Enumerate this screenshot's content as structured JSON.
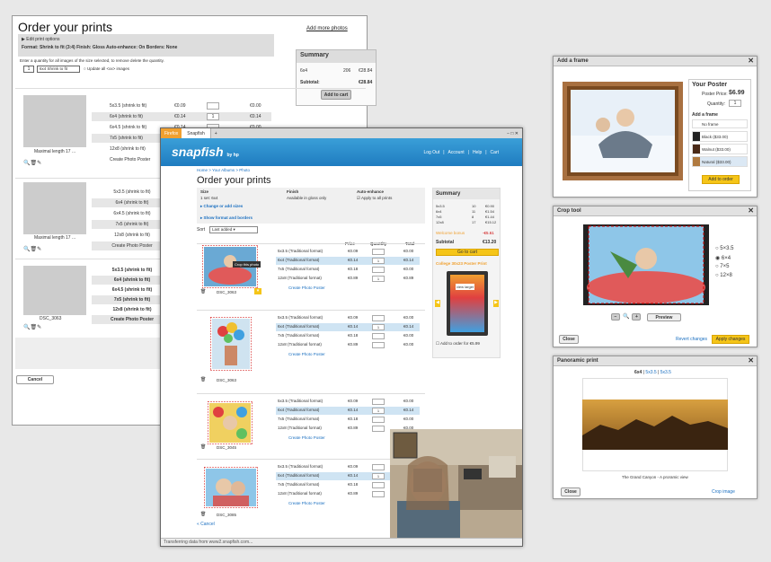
{
  "wireframe": {
    "title": "Order your prints",
    "add_more": "Add more photos",
    "edit_options": "Edit print options",
    "format_line": "Format: Shrink to fit (3:4)   Finish: Gloss   Auto-enhance: On   Borders: None",
    "instruction": "Enter a quantity for all images of the size selected, to remove delete the quantity.",
    "qty_value": "1",
    "size_select": "6x4  Shrink to fit",
    "update_all": "Update all <xx> images",
    "summary_title": "Summary",
    "summary_row": [
      "6x4",
      "206",
      "€28.84"
    ],
    "subtotal_label": "Subtotal:",
    "subtotal_value": "€28.84",
    "add_to_cart": "Add to cart",
    "block1_rows": [
      {
        "label": "5x3.5 (shrink to fit)",
        "price": "€0.09",
        "qty": "",
        "total": "€0.00"
      },
      {
        "label": "6x4 (shrink to fit)",
        "price": "€0.14",
        "qty": "1",
        "total": "€0.14"
      },
      {
        "label": "6x4.5 (shrink to fit)",
        "price": "€0.14",
        "qty": "",
        "total": "€0.00"
      },
      {
        "label": "7x5 (shrink to fit)",
        "price": "€0.18",
        "qty": "",
        "total": "€0.00"
      },
      {
        "label": "12x8 (shrink to fit)",
        "price": "€0.18",
        "qty": "",
        "total": "€0.00"
      },
      {
        "label": "Create Photo Poster",
        "price": "",
        "qty": "",
        "total": ""
      }
    ],
    "caption1": "Maximal length 17 ...",
    "block2_rows": [
      "5x3.5 (shrink to fit)",
      "6x4 (shrink to fit)",
      "6x4.5 (shrink to fit)",
      "7x5 (shrink to fit)",
      "12x8 (shrink to fit)",
      "Create Photo Poster"
    ],
    "caption2": "Maximal length 17 ...",
    "block3_rows": [
      "5x3.5 (shrink to fit)",
      "6x4 (shrink to fit)",
      "6x4.5 (shrink to fit)",
      "7x5 (shrink to fit)",
      "12x8 (shrink to fit)",
      "Create Photo Poster"
    ],
    "caption3": "DSC_3063",
    "cancel": "Cancel"
  },
  "browser": {
    "tab1": "Firefox",
    "tab2": "Snapfish",
    "tab_add": "+",
    "logo": "snapfish",
    "logo_by": "by hp",
    "nav": [
      "Log Out",
      "Account",
      "Help",
      "Cart"
    ],
    "breadcrumb": "Home > Your Albums > Photo",
    "title": "Order your prints",
    "options_headers": [
      "Size",
      "Finish",
      "Auto-enhance"
    ],
    "options_values": [
      "1 set: 6x4",
      "Available in gloss only",
      "Apply to all prints"
    ],
    "change_sizes": "Change or add sizes",
    "show_format": "Show format and borders",
    "sort_label": "Sort",
    "sort_value": "Last added",
    "col_headers": [
      "Price",
      "Quantity",
      "Total"
    ],
    "summary_title": "Summary",
    "summary_rows": [
      [
        "5x3.5",
        "10",
        "€0.90"
      ],
      [
        "6x4",
        "11",
        "€1.54"
      ],
      [
        "7x5",
        "8",
        "€1.44"
      ],
      [
        "12x8",
        "17",
        "€15.12"
      ]
    ],
    "welcome_bonus": "Welcome bonus",
    "welcome_value": "-€5.61",
    "subtotal_label": "Subtotal",
    "subtotal_value": "€13.20",
    "go_to_cart": "Go to cart",
    "poster_title": "College 30x23 Poster Print",
    "poster_btn": "view larger",
    "add_to_order": "Add to order for €5.99",
    "groups": [
      {
        "name": "DSC_3063",
        "rows": [
          [
            "5x3.5 (Traditional format)",
            "€0.09",
            "",
            "€0.00"
          ],
          [
            "6x4 (Traditional format)",
            "€0.14",
            "1",
            "€0.14"
          ],
          [
            "7x5 (Traditional format)",
            "€0.18",
            "",
            "€0.00"
          ],
          [
            "12x8 (Traditional format)",
            "€0.89",
            "1",
            "€0.89"
          ]
        ],
        "poster": "Create Photo Poster",
        "crop_tag": "Crop this photo"
      },
      {
        "name": "DSC_3063",
        "rows": [
          [
            "5x3.5 (Traditional format)",
            "€0.09",
            "",
            "€0.00"
          ],
          [
            "6x4 (Traditional format)",
            "€0.14",
            "1",
            "€0.14"
          ],
          [
            "7x5 (Traditional format)",
            "€0.18",
            "",
            "€0.00"
          ],
          [
            "12x8 (Traditional format)",
            "€0.89",
            "",
            "€0.00"
          ]
        ],
        "poster": "Create Photo Poster"
      },
      {
        "name": "DSC_3045",
        "rows": [
          [
            "5x3.5 (Traditional format)",
            "€0.09",
            "",
            "€0.00"
          ],
          [
            "6x4 (Traditional format)",
            "€0.14",
            "1",
            "€0.14"
          ],
          [
            "7x5 (Traditional format)",
            "€0.18",
            "",
            "€0.00"
          ],
          [
            "12x8 (Traditional format)",
            "€0.89",
            "",
            "€0.00"
          ]
        ],
        "poster": "Create Photo Poster"
      },
      {
        "name": "DSC_3085",
        "rows": [
          [
            "5x3.5 (Traditional format)",
            "€0.09",
            "",
            "€0.00"
          ],
          [
            "6x4 (Traditional format)",
            "€0.14",
            "1",
            "€0.14"
          ],
          [
            "7x5 (Traditional format)",
            "€0.18",
            "",
            "€0.00"
          ],
          [
            "12x8 (Traditional format)",
            "€0.89",
            "",
            "€0.00"
          ]
        ],
        "poster": "Create Photo Poster"
      }
    ],
    "cancel": "« Cancel",
    "status": "Transferring data from www2.snapfish.com..."
  },
  "frame_dialog": {
    "title": "Add a frame",
    "poster_title": "Your Poster",
    "price_label": "Poster Price:",
    "price": "$6.99",
    "qty_label": "Quantity:",
    "qty": "1",
    "add_frame": "Add a frame",
    "no_frame": "No frame",
    "options": [
      "Black ($33.00)",
      "Walnut ($33.00)",
      "Natural ($33.00)"
    ],
    "natural_price": "$33.00",
    "add_to_order": "Add to order"
  },
  "crop_dialog": {
    "title": "Crop tool",
    "sizes": [
      "5×3.5",
      "6×4",
      "7×5",
      "12×8"
    ],
    "selected": 1,
    "zoom_minus": "−",
    "zoom_plus": "+",
    "preview": "Preview",
    "close": "Close",
    "revert": "Revert changes",
    "apply": "Apply changes"
  },
  "panoramic_dialog": {
    "title": "Panoramic print",
    "size_tabs": [
      "6x4",
      "5x3.5",
      "5x3.5"
    ],
    "caption": "The Grand Canyon - A proramic view",
    "close": "Close",
    "crop_image": "Crop image"
  },
  "colors": {
    "snapfish_blue": "#2a8fd0",
    "accent_yellow": "#f5c518",
    "link_blue": "#1a6fc0"
  }
}
